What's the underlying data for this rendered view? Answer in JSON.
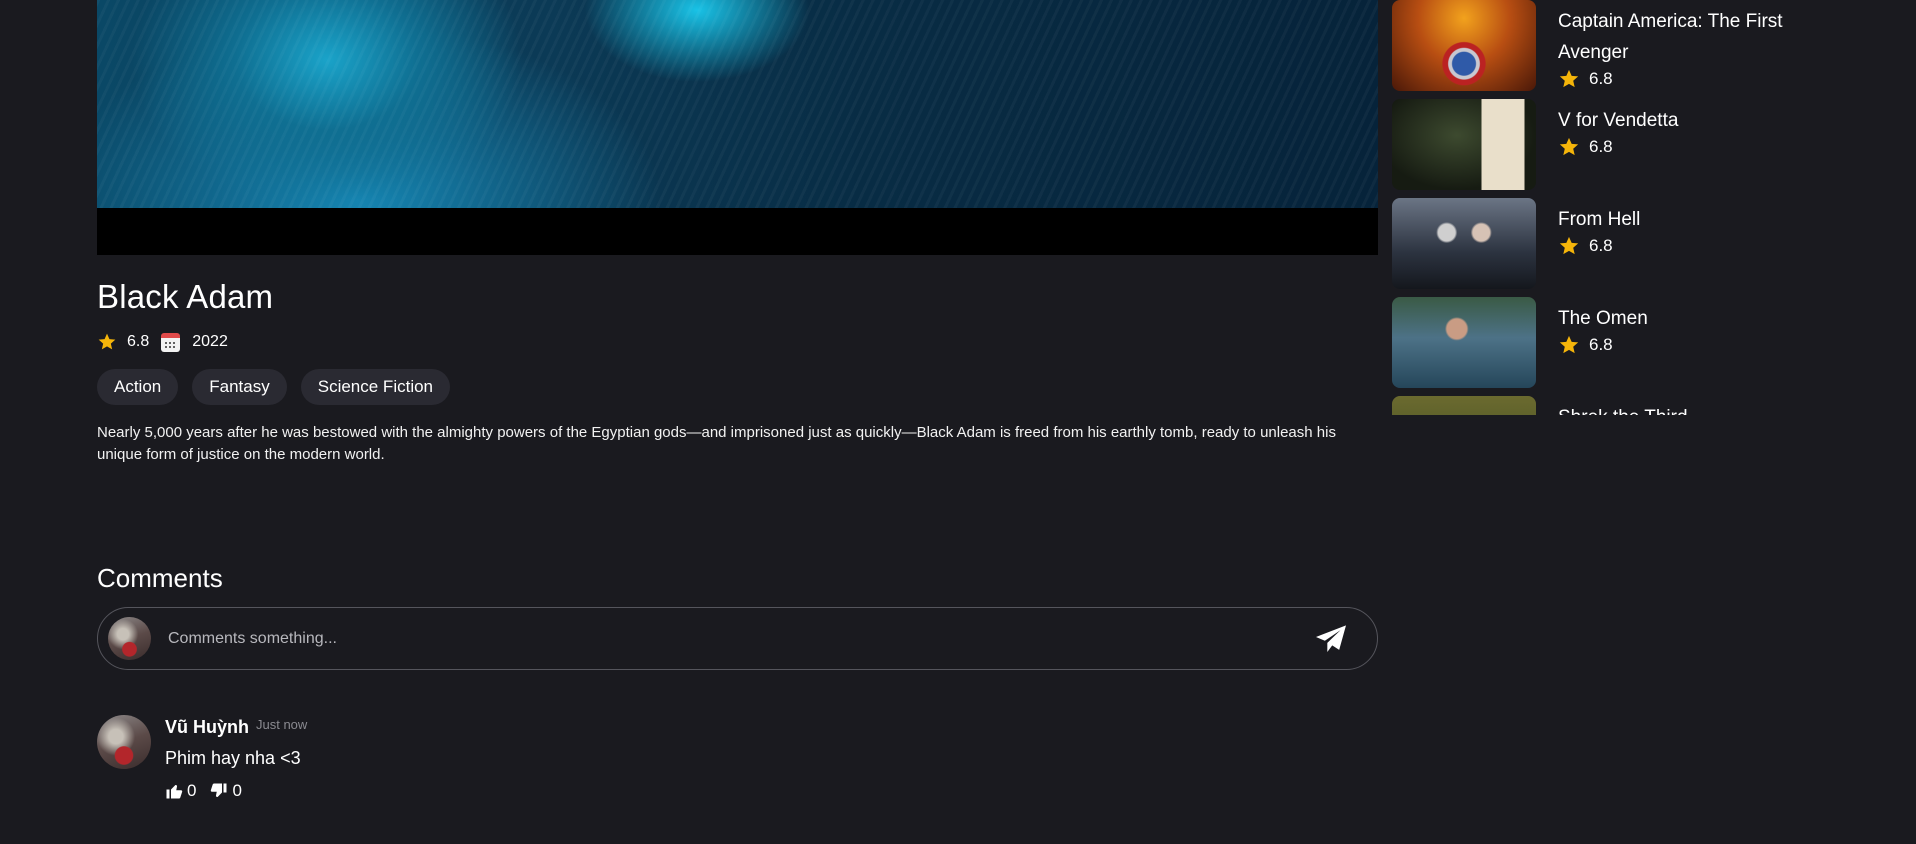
{
  "movie": {
    "title": "Black Adam",
    "rating": "6.8",
    "year": "2022",
    "genres": [
      "Action",
      "Fantasy",
      "Science Fiction"
    ],
    "overview": "Nearly 5,000 years after he was bestowed with the almighty powers of the Egyptian gods—and imprisoned just as quickly—Black Adam is freed from his earthly tomb, ready to unleash his unique form of justice on the modern world."
  },
  "comments": {
    "title": "Comments",
    "input_placeholder": "Comments something...",
    "items": [
      {
        "author": "Vũ Huỳnh",
        "time": "Just now",
        "text": "Phim hay nha <3",
        "likes": "0",
        "dislikes": "0"
      }
    ]
  },
  "recommendations": [
    {
      "title": "Captain America: The First Avenger",
      "rating": "6.8"
    },
    {
      "title": "V for Vendetta",
      "rating": "6.8"
    },
    {
      "title": "From Hell",
      "rating": "6.8"
    },
    {
      "title": "The Omen",
      "rating": "6.8"
    },
    {
      "title": "Shrek the Third",
      "rating": ""
    }
  ],
  "colors": {
    "background": "#1a1a1f",
    "star": "#f5b50a",
    "chip": "#2a2a32"
  }
}
